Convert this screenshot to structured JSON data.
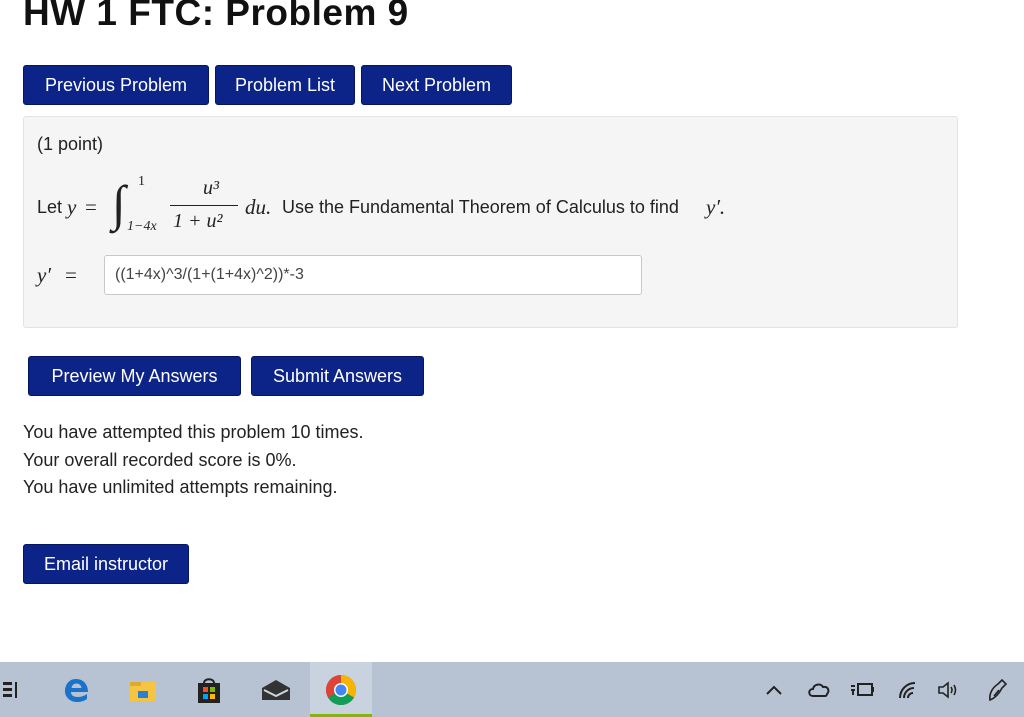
{
  "page": {
    "title": "HW 1 FTC: Problem 9"
  },
  "nav": {
    "previous_label": "Previous Problem",
    "list_label": "Problem List",
    "next_label": "Next Problem"
  },
  "problem": {
    "points": "(1 point)",
    "let_text": "Let",
    "y_var": "y",
    "equals": "=",
    "integral_upper": "1",
    "integral_lower": "1−4x",
    "numerator": "u³",
    "denominator": "1 + u²",
    "differential": "du.",
    "instruction": "Use the Fundamental Theorem of Calculus to find",
    "y_prime": "y′.",
    "answer_label": "y′",
    "answer_equals": "=",
    "answer_value": "((1+4x)^3/(1+(1+4x)^2))*-3"
  },
  "actions": {
    "preview_label": "Preview My Answers",
    "submit_label": "Submit Answers"
  },
  "status": {
    "attempts": "You have attempted this problem 10 times.",
    "score": "Your overall recorded score is 0%.",
    "remaining": "You have unlimited attempts remaining."
  },
  "email": {
    "label": "Email instructor"
  },
  "taskbar": {
    "color": "#b7c3d3",
    "apps": [
      "task-view-icon",
      "edge-icon",
      "file-explorer-icon",
      "store-icon",
      "mail-icon",
      "chrome-icon"
    ],
    "tray": [
      "show-hidden-icons",
      "onedrive-icon",
      "battery-icon",
      "wifi-icon",
      "volume-icon",
      "pen-icon"
    ]
  }
}
